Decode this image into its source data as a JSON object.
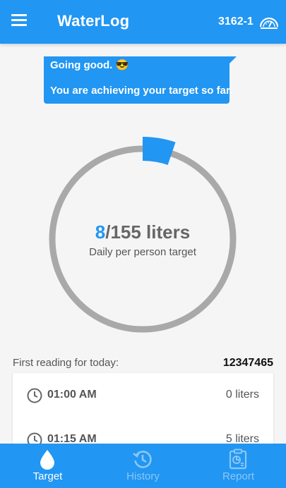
{
  "app": {
    "title": "WaterLog",
    "meter_id": "3162-1"
  },
  "message": {
    "status": "Going good. 😎",
    "text": "You are achieving your target so far."
  },
  "usage": {
    "current": "8",
    "target_suffix": "/155 liters",
    "caption": "Daily per person target",
    "progress_fraction": 0.052
  },
  "reading": {
    "label": "First reading for today:",
    "value": "12347465"
  },
  "readings": [
    {
      "time": "01:00 AM",
      "amount": "0 liters"
    },
    {
      "time": "01:15 AM",
      "amount": "5 liters"
    }
  ],
  "nav": {
    "items": [
      {
        "label": "Target",
        "icon": "water-drop-icon",
        "active": true
      },
      {
        "label": "History",
        "icon": "history-icon",
        "active": false
      },
      {
        "label": "Report",
        "icon": "report-icon",
        "active": false
      }
    ]
  },
  "colors": {
    "primary": "#2196f3",
    "ring_track": "#a9a9a9",
    "inactive_nav": "#8cc7f5"
  }
}
